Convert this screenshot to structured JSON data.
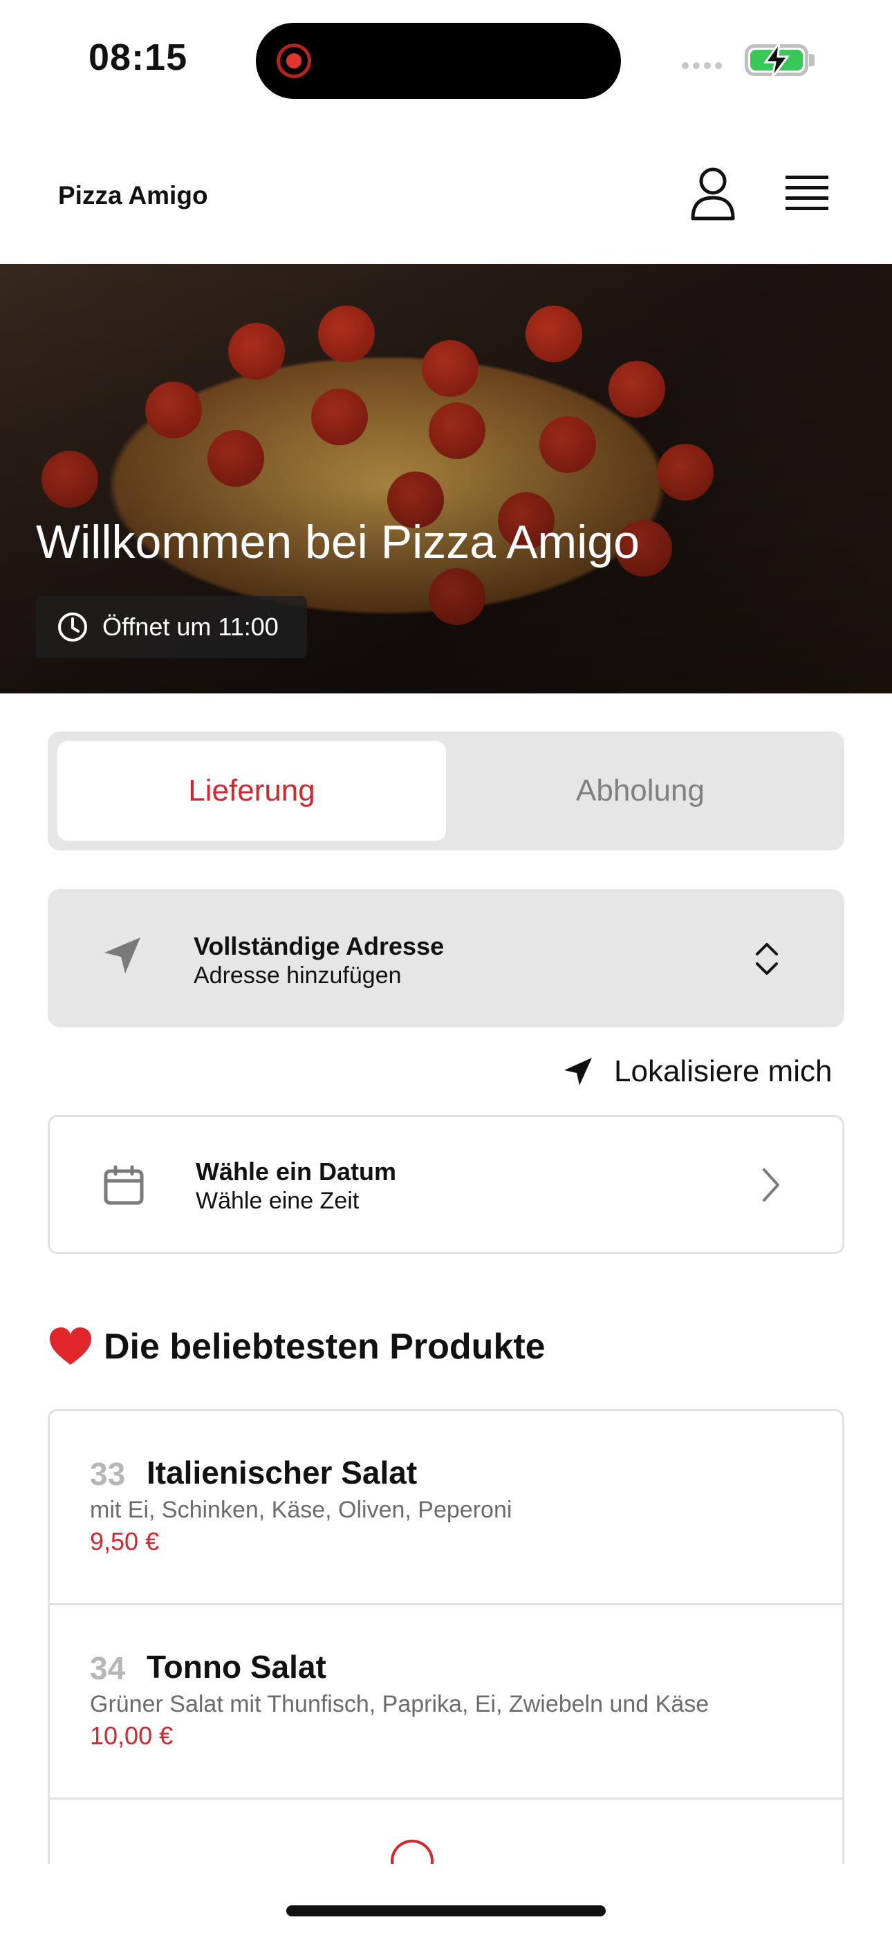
{
  "status_bar": {
    "time": "08:15"
  },
  "header": {
    "brand": "Pizza Amigo"
  },
  "hero": {
    "title": "Willkommen bei Pizza Amigo",
    "opening": "Öffnet um 11:00"
  },
  "mode_tabs": {
    "active": "Lieferung",
    "inactive": "Abholung"
  },
  "address": {
    "title": "Vollständige Adresse",
    "subtitle": "Adresse hinzufügen"
  },
  "locate": {
    "label": "Lokalisiere mich"
  },
  "schedule": {
    "title": "Wähle ein Datum",
    "subtitle": "Wähle eine Zeit"
  },
  "popular": {
    "title": "Die beliebtesten Produkte",
    "items": [
      {
        "number": "33",
        "name": "Italienischer Salat",
        "description": "mit Ei, Schinken, Käse, Oliven, Peperoni",
        "price": "9,50 €"
      },
      {
        "number": "34",
        "name": "Tonno Salat",
        "description": "Grüner Salat mit Thunfisch, Paprika, Ei, Zwiebeln und Käse",
        "price": "10,00 €"
      }
    ]
  },
  "icons": [
    "user-icon",
    "menu-icon",
    "clock-icon",
    "location-arrow-icon",
    "chevron-updown-icon",
    "navigation-icon",
    "calendar-icon",
    "chevron-right-icon",
    "heart-icon",
    "info-icon"
  ],
  "colors": {
    "accent": "#d3262d",
    "panel": "#e6e6e6",
    "border": "#e1e1e1",
    "battery": "#38c859"
  }
}
